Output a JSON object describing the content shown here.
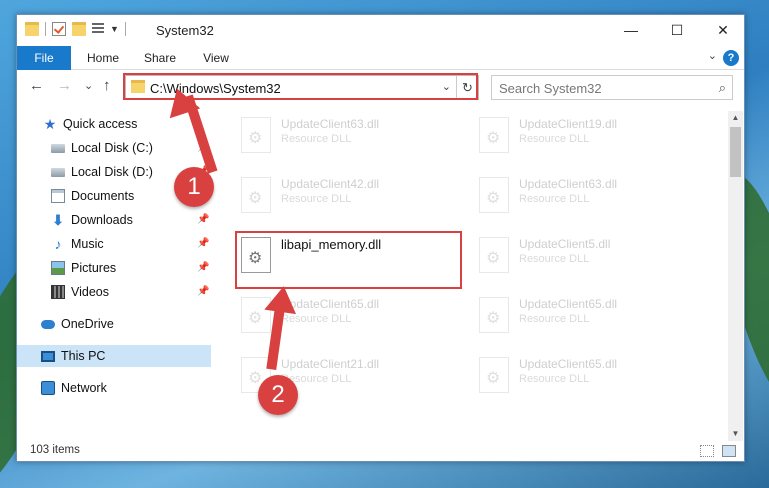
{
  "window": {
    "title": "System32",
    "minimize": "—",
    "maximize": "☐",
    "close": "✕"
  },
  "ribbon": {
    "tabs": [
      "File",
      "Home",
      "Share",
      "View"
    ],
    "help": "?",
    "expand": "⌄"
  },
  "navbar": {
    "back": "←",
    "forward": "→",
    "recent": "⌄",
    "up": "↑",
    "address": "C:\\Windows\\System32",
    "search_placeholder": "Search System32",
    "refresh": "↻",
    "search_icon": "⌕"
  },
  "sidebar": {
    "items": [
      {
        "label": "Quick access",
        "icon": "star-icon",
        "pinned": false
      },
      {
        "label": "Local Disk (C:)",
        "icon": "disk-icon",
        "pinned": true
      },
      {
        "label": "Local Disk (D:)",
        "icon": "disk-icon",
        "pinned": true
      },
      {
        "label": "Documents",
        "icon": "document-icon",
        "pinned": true
      },
      {
        "label": "Downloads",
        "icon": "download-icon",
        "pinned": true
      },
      {
        "label": "Music",
        "icon": "music-icon",
        "pinned": true
      },
      {
        "label": "Pictures",
        "icon": "pictures-icon",
        "pinned": true
      },
      {
        "label": "Videos",
        "icon": "videos-icon",
        "pinned": true
      },
      {
        "label": "OneDrive",
        "icon": "cloud-icon",
        "pinned": false
      },
      {
        "label": "This PC",
        "icon": "computer-icon",
        "pinned": false,
        "selected": true
      },
      {
        "label": "Network",
        "icon": "network-icon",
        "pinned": false
      }
    ]
  },
  "files": [
    {
      "name": "UpdateClient63.dll",
      "type": "Resource DLL"
    },
    {
      "name": "UpdateClient19.dll",
      "type": "Resource DLL"
    },
    {
      "name": "UpdateClient42.dll",
      "type": "Resource DLL"
    },
    {
      "name": "UpdateClient63.dll",
      "type": "Resource DLL"
    },
    {
      "name": "libapi_memory.dll",
      "type": "",
      "highlighted": true
    },
    {
      "name": "UpdateClient5.dll",
      "type": "Resource DLL"
    },
    {
      "name": "UpdateClient65.dll",
      "type": "Resource DLL"
    },
    {
      "name": "UpdateClient65.dll",
      "type": "Resource DLL"
    },
    {
      "name": "UpdateClient21.dll",
      "type": "Resource DLL"
    },
    {
      "name": "UpdateClient65.dll",
      "type": "Resource DLL"
    }
  ],
  "status": {
    "item_count": "103 items"
  },
  "annotations": {
    "step1": "1",
    "step2": "2",
    "color": "#d94040"
  }
}
